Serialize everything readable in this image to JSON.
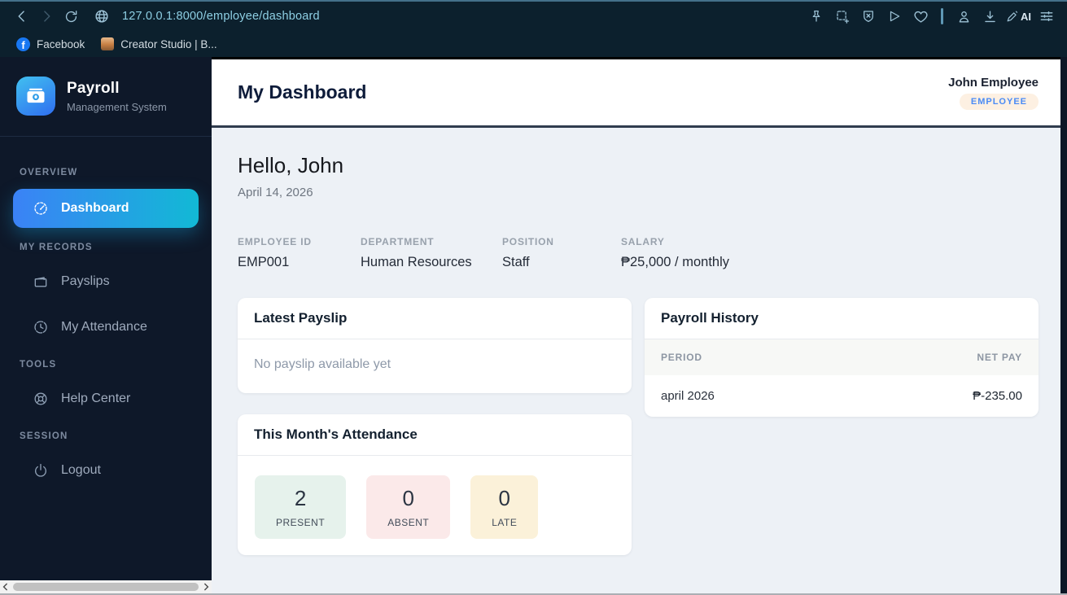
{
  "browser": {
    "url": "127.0.0.1:8000/employee/dashboard",
    "ai_label": "AI",
    "bookmarks": [
      {
        "label": "Facebook"
      },
      {
        "label": "Creator Studio | B..."
      }
    ]
  },
  "sidebar": {
    "logo_title": "Payroll",
    "logo_subtitle": "Management System",
    "sections": [
      {
        "label": "OVERVIEW",
        "items": [
          {
            "label": "Dashboard",
            "icon": "gauge-icon",
            "active": true
          }
        ]
      },
      {
        "label": "MY RECORDS",
        "items": [
          {
            "label": "Payslips",
            "icon": "wallet-icon"
          },
          {
            "label": "My Attendance",
            "icon": "clock-icon"
          }
        ]
      },
      {
        "label": "TOOLS",
        "items": [
          {
            "label": "Help Center",
            "icon": "lifebuoy-icon"
          }
        ]
      },
      {
        "label": "SESSION",
        "items": [
          {
            "label": "Logout",
            "icon": "power-icon"
          }
        ]
      }
    ]
  },
  "header": {
    "title": "My Dashboard",
    "user_name": "John Employee",
    "user_role": "EMPLOYEE"
  },
  "main": {
    "greeting": "Hello, John",
    "date": "April 14, 2026",
    "info": [
      {
        "label": "EMPLOYEE ID",
        "value": "EMP001"
      },
      {
        "label": "DEPARTMENT",
        "value": "Human Resources"
      },
      {
        "label": "POSITION",
        "value": "Staff"
      },
      {
        "label": "SALARY",
        "value": "₱25,000 / monthly"
      }
    ],
    "latest_payslip": {
      "title": "Latest Payslip",
      "empty_message": "No payslip available yet"
    },
    "payroll_history": {
      "title": "Payroll History",
      "columns": [
        "PERIOD",
        "NET PAY"
      ],
      "rows": [
        {
          "period": "april 2026",
          "net_pay": "₱-235.00"
        }
      ]
    },
    "attendance": {
      "title": "This Month's Attendance",
      "stats": [
        {
          "value": "2",
          "label": "PRESENT",
          "color": "green"
        },
        {
          "value": "0",
          "label": "ABSENT",
          "color": "red"
        },
        {
          "value": "0",
          "label": "LATE",
          "color": "yellow"
        }
      ]
    }
  },
  "colors": {
    "active_gradient_start": "#3b82f6",
    "active_gradient_end": "#12b9d5",
    "badge_bg": "#fdf0e2",
    "badge_text": "#4b8bf5",
    "tile_present_bg": "#e6f2ec",
    "tile_absent_bg": "#fbe9e9",
    "tile_late_bg": "#fbf1d9",
    "sidebar_bg": "#0e1829",
    "chrome_bg": "#0c202d",
    "content_bg": "#edf1f6"
  }
}
